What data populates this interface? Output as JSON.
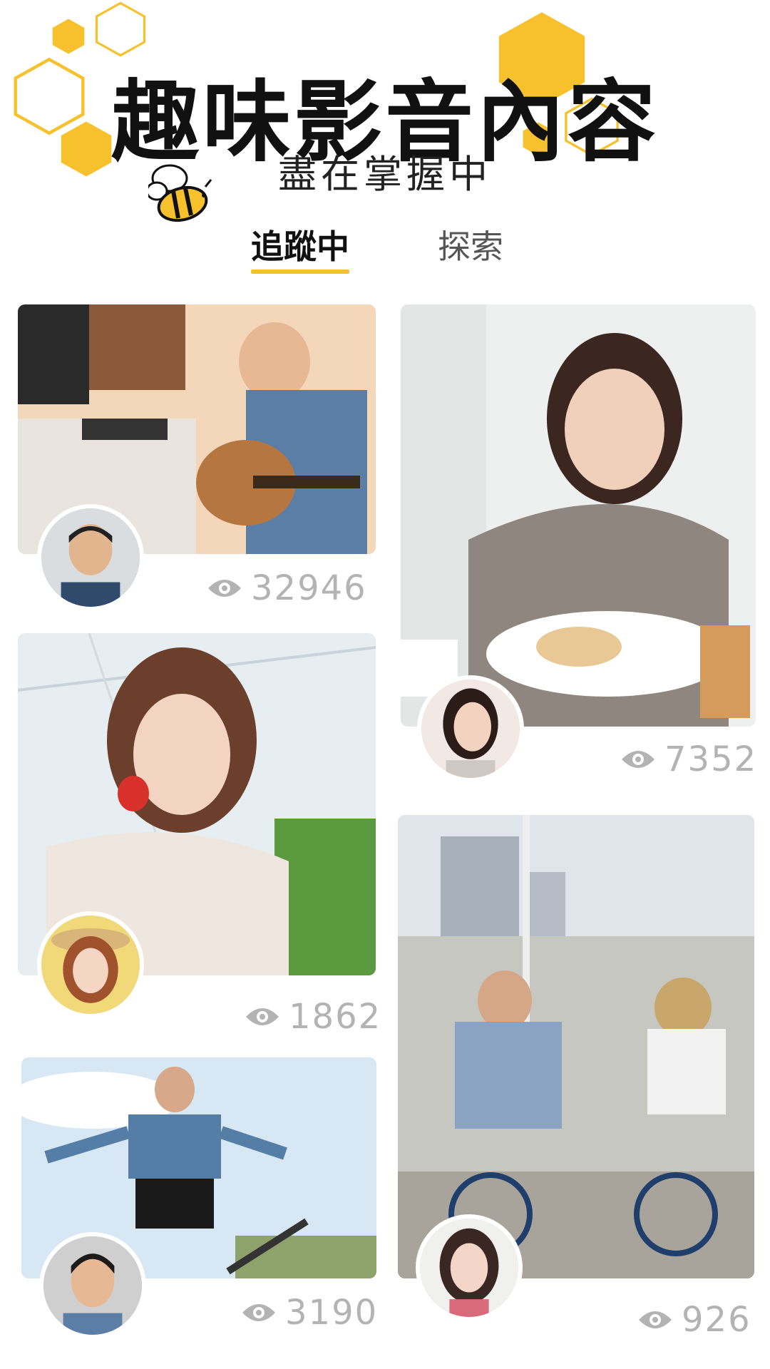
{
  "header": {
    "title": "趣味影音內容",
    "subtitle": "盡在掌握中"
  },
  "tabs": [
    {
      "label": "追蹤中",
      "active": true
    },
    {
      "label": "探索",
      "active": false
    }
  ],
  "colors": {
    "accent": "#f6c12c",
    "views": "#b3b3b3"
  },
  "feed": [
    {
      "photo": "man-playing-guitar",
      "avatar": "smiling-man",
      "views": "32946"
    },
    {
      "photo": "woman-eating-cake",
      "avatar": "smiling-woman",
      "views": "7352"
    },
    {
      "photo": "woman-with-strawberry",
      "avatar": "woman-in-hat",
      "views": "1862"
    },
    {
      "photo": "couple-on-bicycles",
      "avatar": "young-woman",
      "views": "926"
    },
    {
      "photo": "man-skateboarding",
      "avatar": "man-with-short-hair",
      "views": "3190"
    }
  ],
  "icons": [
    "bee-mascot-icon",
    "eye-icon"
  ]
}
